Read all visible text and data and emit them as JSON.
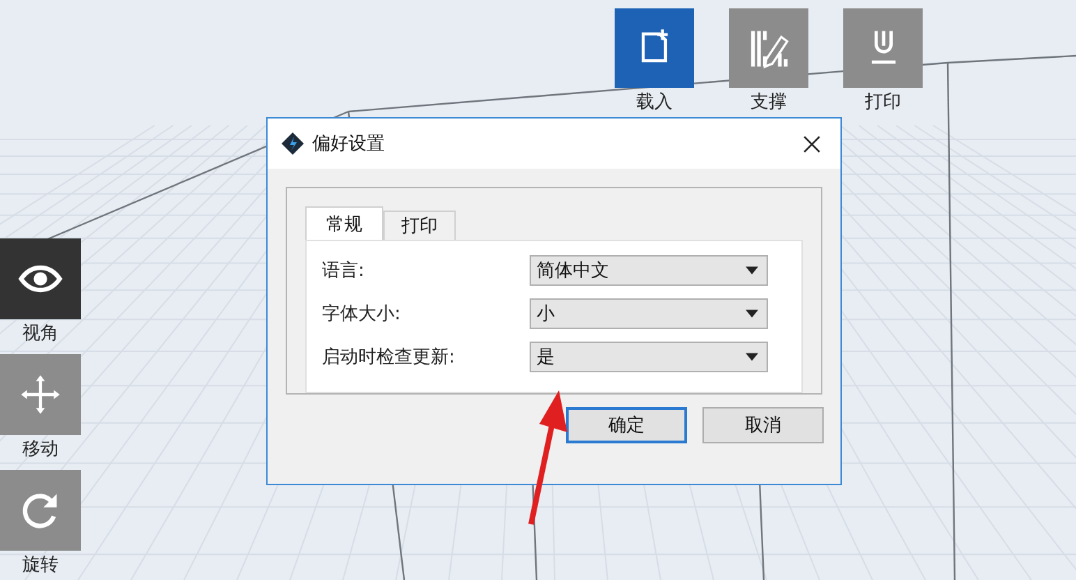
{
  "top_toolbar": [
    {
      "label": "载入",
      "kind": "load",
      "highlighted": true
    },
    {
      "label": "支撑",
      "kind": "support",
      "highlighted": false
    },
    {
      "label": "打印",
      "kind": "print",
      "highlighted": false
    }
  ],
  "side_toolbar": [
    {
      "label": "视角",
      "kind": "view",
      "selected": true
    },
    {
      "label": "移动",
      "kind": "move",
      "selected": false
    },
    {
      "label": "旋转",
      "kind": "rotate",
      "selected": false
    }
  ],
  "dialog": {
    "title": "偏好设置",
    "tabs": [
      {
        "label": "常规",
        "selected": true
      },
      {
        "label": "打印",
        "selected": false
      }
    ],
    "settings": [
      {
        "label": "语言:",
        "value": "简体中文"
      },
      {
        "label": "字体大小:",
        "value": "小"
      },
      {
        "label": "启动时检查更新:",
        "value": "是"
      }
    ],
    "buttons": [
      {
        "label": "确定",
        "focused": true
      },
      {
        "label": "取消",
        "focused": false
      }
    ]
  }
}
